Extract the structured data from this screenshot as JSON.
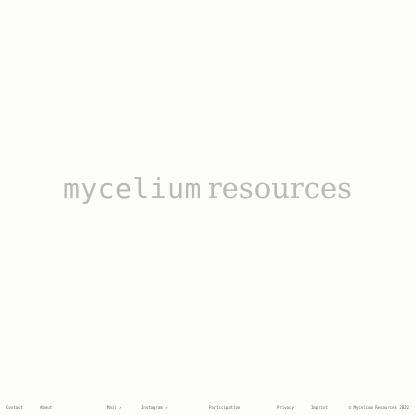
{
  "hero": {
    "word1": "mycelium",
    "word2": "resources"
  },
  "footer": {
    "links": {
      "contact": "Contact",
      "about": "About",
      "mail": "Mail ↗",
      "instagram": "Instagram ↗",
      "participation": "Participation",
      "privacy": "Privacy",
      "imprint": "Imprint"
    },
    "copyright": "© Mycelium Resources 2022"
  },
  "colors": {
    "background": "#fdfdfb",
    "hero_text": "#b9b9b6",
    "footer_text": "#5e5e5e"
  }
}
